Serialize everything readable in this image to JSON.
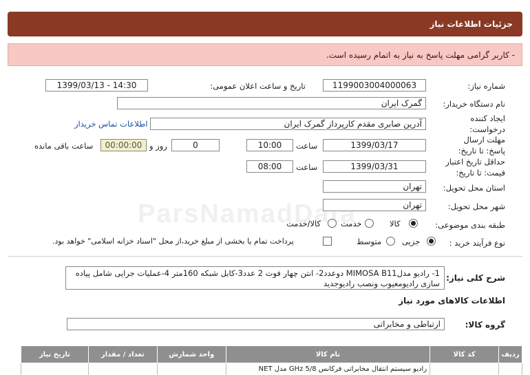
{
  "header": {
    "title": "جزئیات اطلاعات نیاز"
  },
  "alert": {
    "message": "- کاربر گرامی مهلت پاسخ به نیاز به اتمام رسیده است."
  },
  "fields": {
    "need_number_label": "شماره نیاز:",
    "need_number": "1199003004000063",
    "announce_label": "تاریخ و ساعت اعلان عمومی:",
    "announce_value": "1399/03/13 - 14:30",
    "buyer_label": "نام دستگاه خریدار:",
    "buyer_value": "گمرک ایران",
    "creator_label": "ایجاد کننده درخواست:",
    "creator_value": "آدرین صابری مقدم کارپرداز گمرک ایران",
    "contact_link": "اطلاعات تماس خریدار",
    "deadline_label": "مهلت ارسال پاسخ: تا تاریخ:",
    "deadline_date": "1399/03/17",
    "time_label": "ساعت",
    "deadline_time": "10:00",
    "day_label": "روز و",
    "days_value": "0",
    "remaining_value": "00:00:00",
    "remaining_label": "ساعت باقی مانده",
    "min_validity_label": "حداقل تاریخ اعتبار قیمت: تا تاریخ:",
    "validity_date": "1399/03/31",
    "validity_time": "08:00",
    "province_label": "استان محل تحویل:",
    "province_value": "تهران",
    "city_label": "شهر محل تحویل:",
    "city_value": "تهران",
    "category_label": "طبقه بندی موضوعی:",
    "category_options": [
      "کالا",
      "خدمت",
      "کالا/خدمت"
    ],
    "process_label": "نوع فرآیند خرید :",
    "process_options": [
      "جزیی",
      "متوسط"
    ],
    "payment_note": "پرداخت تمام یا بخشی از مبلغ خرید،از محل \"اسناد خزانه اسلامی\" خواهد بود."
  },
  "description": {
    "label": "شرح کلی نیاز:",
    "text": "1- رادیو مدلMIMOSA  B11 دوعدد2- انتن چهار فوت 2 عدد3-کابل شبکه 160متر 4-عملیات جرایی شامل پیاده سازی رادیومعیوب ونصب رادیوجدید"
  },
  "goods_info": {
    "title": "اطلاعات کالاهای مورد نیاز",
    "group_label": "گروه کالا:",
    "group_value": "ارتباطی و مخابراتی"
  },
  "table": {
    "headers": [
      "ردیف",
      "کد کالا",
      "نام کالا",
      "واحد شمارش",
      "تعداد / مقدار",
      "تاریخ نیاز"
    ],
    "rows": [
      [
        "",
        "",
        "رادیو سیستم انتقال مخابراتی فرکانس GHz 5/8 مدل NET",
        "",
        "",
        ""
      ]
    ]
  },
  "watermark": "ParsNamadData"
}
